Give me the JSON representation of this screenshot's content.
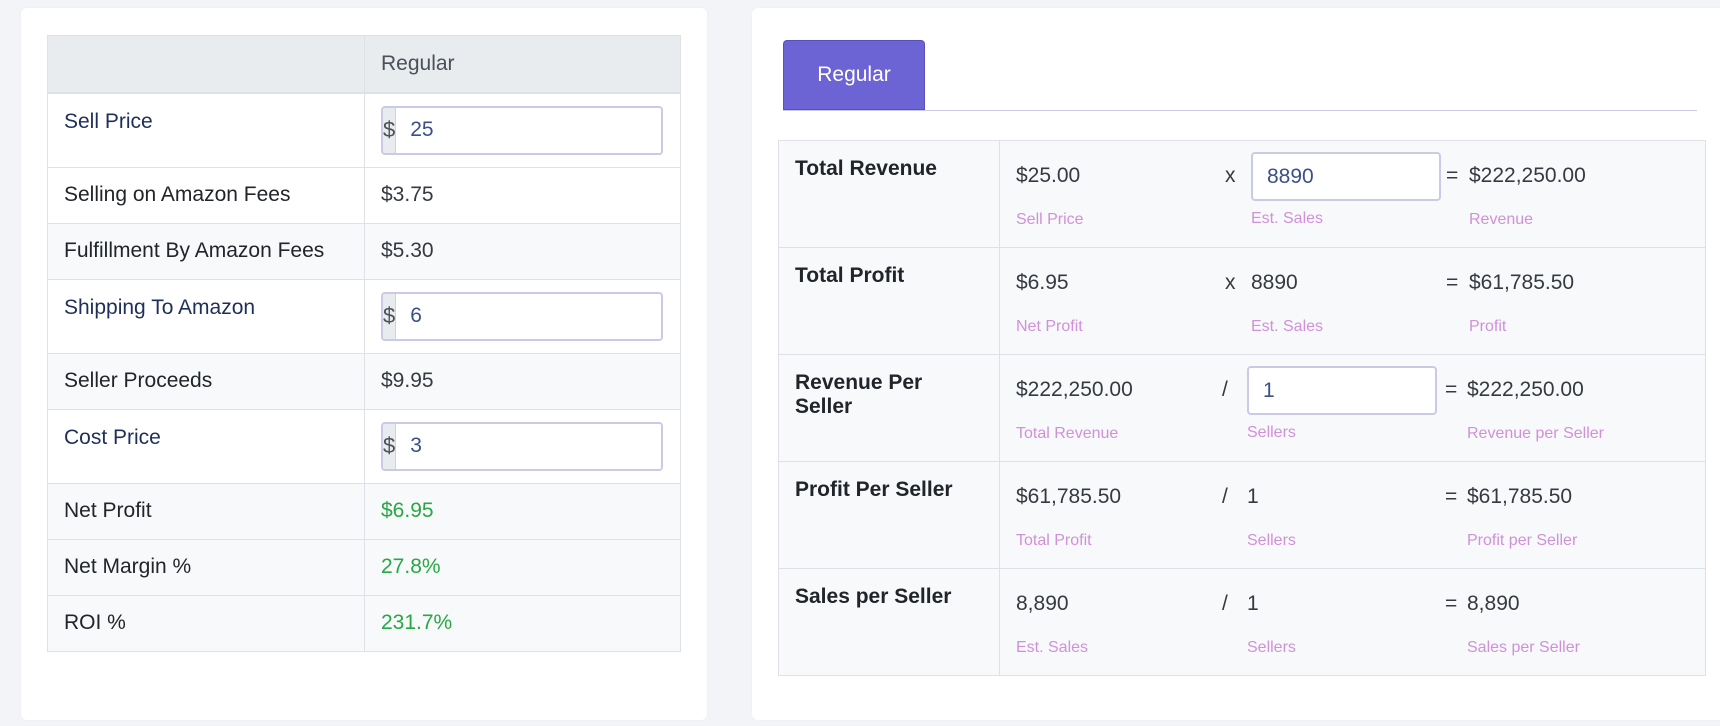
{
  "left": {
    "header": {
      "blank": "",
      "column": "Regular"
    },
    "rows": [
      {
        "label": "Sell Price",
        "type": "input",
        "prefix": "$",
        "value": "25"
      },
      {
        "label": "Selling on Amazon Fees",
        "type": "value",
        "value": "$3.75"
      },
      {
        "label": "Fulfillment By Amazon Fees",
        "type": "value",
        "value": "$5.30"
      },
      {
        "label": "Shipping To Amazon",
        "type": "input",
        "prefix": "$",
        "value": "6"
      },
      {
        "label": "Seller Proceeds",
        "type": "value",
        "value": "$9.95"
      },
      {
        "label": "Cost Price",
        "type": "input",
        "prefix": "$",
        "value": "3"
      },
      {
        "label": "Net Profit",
        "type": "value",
        "value": "$6.95"
      },
      {
        "label": "Net Margin %",
        "type": "value",
        "value": "27.8%"
      },
      {
        "label": "ROI %",
        "type": "value",
        "value": "231.7%"
      }
    ]
  },
  "right": {
    "tab": "Regular",
    "rows": [
      {
        "label": "Total Revenue",
        "a": "$25.00",
        "a_sub": "Sell Price",
        "op": "x",
        "b": "8890",
        "b_sub": "Est. Sales",
        "eq": "=",
        "c": "$222,250.00",
        "c_sub": "Revenue"
      },
      {
        "label": "Total Profit",
        "a": "$6.95",
        "a_sub": "Net Profit",
        "op": "x",
        "b": "8890",
        "b_sub": "Est. Sales",
        "eq": "=",
        "c": "$61,785.50",
        "c_sub": "Profit"
      },
      {
        "label": "Revenue Per Seller",
        "a": "$222,250.00",
        "a_sub": "Total Revenue",
        "op": "/",
        "b": "1",
        "b_sub": "Sellers",
        "eq": "=",
        "c": "$222,250.00",
        "c_sub": "Revenue per Seller"
      },
      {
        "label": "Profit Per Seller",
        "a": "$61,785.50",
        "a_sub": "Total Profit",
        "op": "/",
        "b": "1",
        "b_sub": "Sellers",
        "eq": "=",
        "c": "$61,785.50",
        "c_sub": "Profit per Seller"
      },
      {
        "label": "Sales per Seller",
        "a": "8,890",
        "a_sub": "Est. Sales",
        "op": "/",
        "b": "1",
        "b_sub": "Sellers",
        "eq": "=",
        "c": "8,890",
        "c_sub": "Sales per Seller"
      }
    ]
  },
  "icons": {
    "sell_price_field_icon": "contact-card-icon"
  },
  "colors": {
    "accent": "#6c63d4",
    "positive": "#28a745",
    "sublabel": "#d091d8"
  }
}
